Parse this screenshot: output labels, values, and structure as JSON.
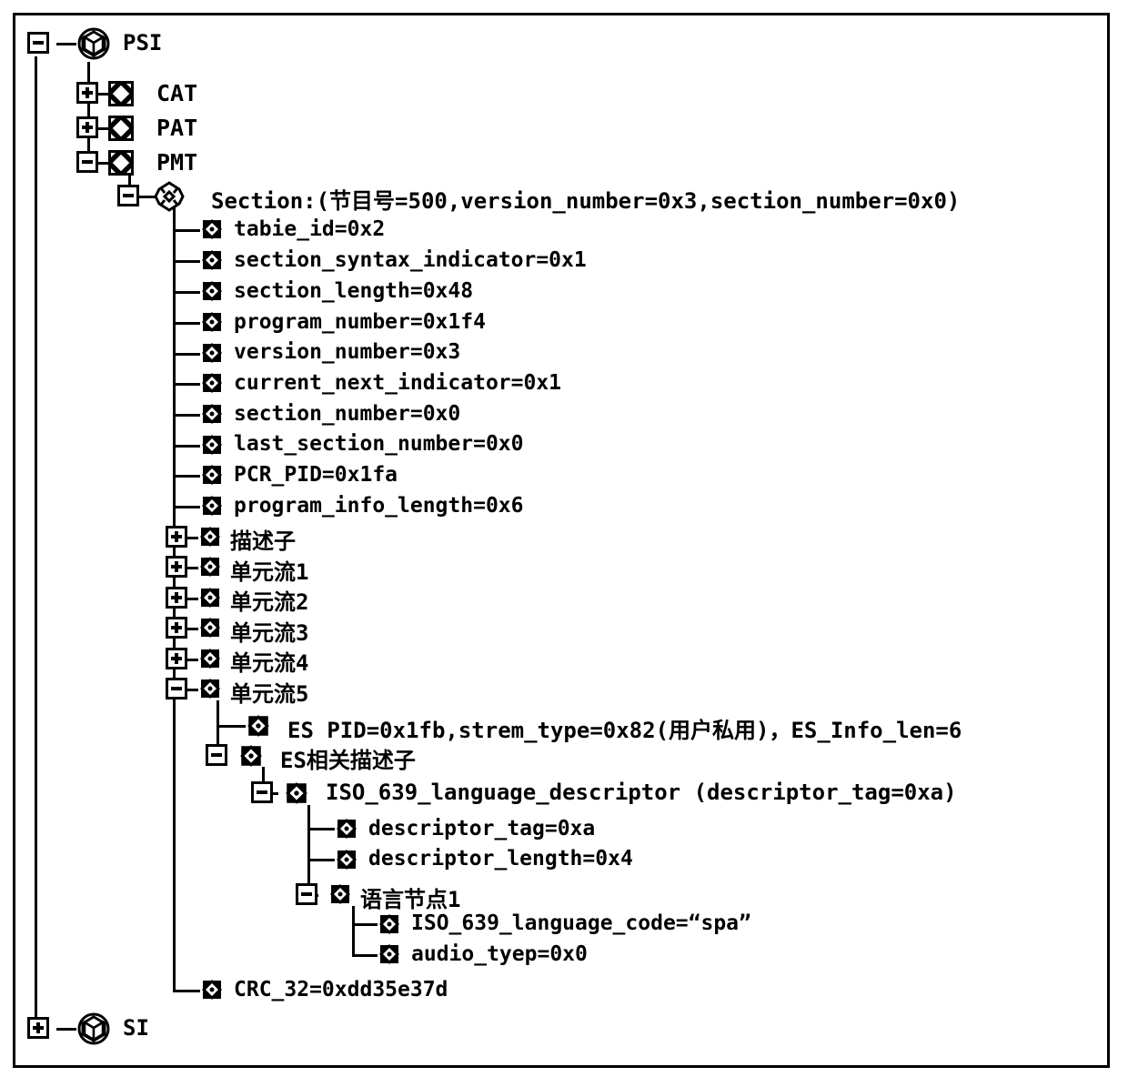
{
  "diagram": {
    "title": "PSI/SI MPEG-2 section tree view",
    "type": "tree-view",
    "colors": {
      "background": "#ffffff",
      "stroke": "#000000",
      "text": "#000000"
    }
  },
  "nodes": {
    "psi": {
      "label": "PSI",
      "icon": "cube-in-circle-icon",
      "expander": "minus",
      "state": "expanded"
    },
    "cat": {
      "label": "CAT",
      "icon": "table-diamond-icon",
      "expander": "plus",
      "state": "collapsed"
    },
    "pat": {
      "label": "PAT",
      "icon": "table-diamond-icon",
      "expander": "plus",
      "state": "collapsed"
    },
    "pmt": {
      "label": "PMT",
      "icon": "table-diamond-icon",
      "expander": "minus",
      "state": "expanded"
    },
    "section": {
      "label": "Section:(节目号=500,version_number=0x3,section_number=0x0)",
      "icon": "section-diamond-icon",
      "expander": "minus",
      "state": "expanded"
    },
    "fields": [
      {
        "label": "tabie_id=0x2",
        "icon": "leaf-diamond-icon"
      },
      {
        "label": "section_syntax_indicator=0x1",
        "icon": "leaf-diamond-icon"
      },
      {
        "label": "section_length=0x48",
        "icon": "leaf-diamond-icon"
      },
      {
        "label": "program_number=0x1f4",
        "icon": "leaf-diamond-icon"
      },
      {
        "label": "version_number=0x3",
        "icon": "leaf-diamond-icon"
      },
      {
        "label": "current_next_indicator=0x1",
        "icon": "leaf-diamond-icon"
      },
      {
        "label": "section_number=0x0",
        "icon": "leaf-diamond-icon"
      },
      {
        "label": "last_section_number=0x0",
        "icon": "leaf-diamond-icon"
      },
      {
        "label": "PCR_PID=0x1fa",
        "icon": "leaf-diamond-icon"
      },
      {
        "label": "program_info_length=0x6",
        "icon": "leaf-diamond-icon"
      }
    ],
    "branches": [
      {
        "label": "描述子",
        "icon": "leaf-diamond-icon",
        "expander": "plus",
        "state": "collapsed"
      },
      {
        "label": "单元流1",
        "icon": "leaf-diamond-icon",
        "expander": "plus",
        "state": "collapsed"
      },
      {
        "label": "单元流2",
        "icon": "leaf-diamond-icon",
        "expander": "plus",
        "state": "collapsed"
      },
      {
        "label": "单元流3",
        "icon": "leaf-diamond-icon",
        "expander": "plus",
        "state": "collapsed"
      },
      {
        "label": "单元流4",
        "icon": "leaf-diamond-icon",
        "expander": "plus",
        "state": "collapsed"
      },
      {
        "label": "单元流5",
        "icon": "leaf-diamond-icon",
        "expander": "minus",
        "state": "expanded"
      }
    ],
    "es": {
      "pid_line": "ES PID=0x1fb,strem_type=0x82(用户私用)，ES_Info_len=6",
      "descriptors_label": "ES相关描述子",
      "iso639": {
        "label": "ISO_639_language_descriptor (descriptor_tag=0xa)",
        "fields": [
          {
            "label": "descriptor_tag=0xa",
            "icon": "leaf-diamond-icon"
          },
          {
            "label": "descriptor_length=0x4",
            "icon": "leaf-diamond-icon"
          }
        ],
        "language_node": {
          "label": "语言节点1",
          "expander": "minus",
          "state": "expanded",
          "fields": [
            {
              "label": "ISO_639_language_code=“spa”",
              "icon": "leaf-diamond-icon"
            },
            {
              "label": "audio_tyep=0x0",
              "icon": "leaf-diamond-icon"
            }
          ]
        }
      }
    },
    "crc": {
      "label": "CRC_32=0xdd35e37d",
      "icon": "leaf-diamond-icon"
    },
    "si": {
      "label": "SI",
      "icon": "cube-in-circle-icon",
      "expander": "plus",
      "state": "collapsed"
    }
  }
}
